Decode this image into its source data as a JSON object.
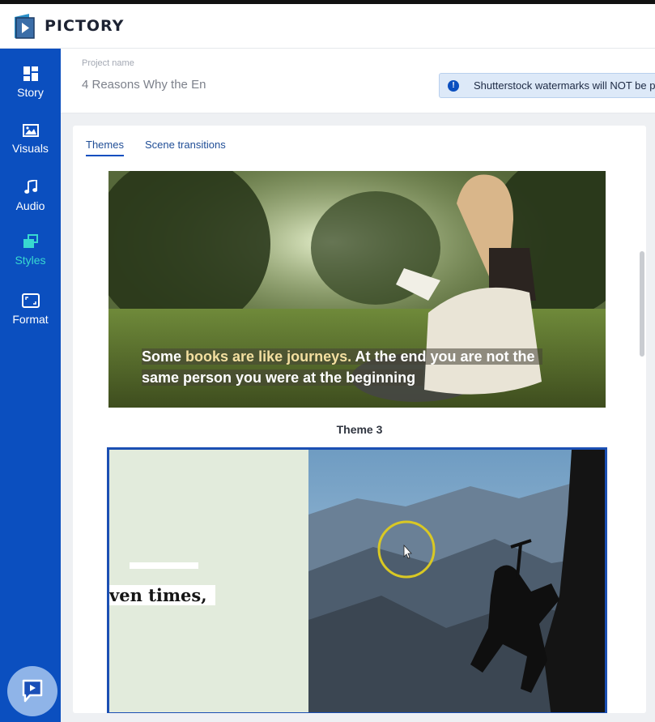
{
  "app": {
    "brand": "PICTORY"
  },
  "sidebar": {
    "items": [
      {
        "label": "Story",
        "icon": "dashboard-icon"
      },
      {
        "label": "Visuals",
        "icon": "image-icon"
      },
      {
        "label": "Audio",
        "icon": "music-note-icon"
      },
      {
        "label": "Styles",
        "icon": "styles-icon",
        "active": true
      },
      {
        "label": "Format",
        "icon": "format-icon"
      }
    ]
  },
  "project": {
    "label": "Project name",
    "name": "4 Reasons Why the En"
  },
  "notice": {
    "text": "Shutterstock watermarks will NOT be pr",
    "icon": "info-icon"
  },
  "tabs": [
    {
      "label": "Themes",
      "active": true
    },
    {
      "label": "Scene transitions",
      "active": false
    }
  ],
  "themes": [
    {
      "caption_line1_pre": "Some ",
      "caption_line1_hl": "books are like journeys.",
      "caption_line1_post": " At the end you are not the",
      "caption_line2": "same person you were at the beginning",
      "label": "Theme 3"
    },
    {
      "caption": "ven times,"
    }
  ],
  "colors": {
    "sidebar": "#0b4fbf",
    "active_nav": "#38d9d0",
    "tab_text": "#1f4d96",
    "notice_bg": "#dde9f8",
    "selected_border": "#1b4fb3"
  }
}
